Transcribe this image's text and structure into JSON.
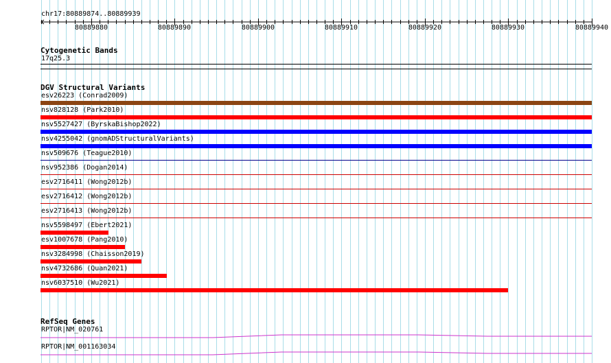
{
  "ruler": {
    "region": "chr17:80889874..80889939",
    "ticks": [
      "80889880",
      "80889890",
      "80889900",
      "80889910",
      "80889920",
      "80889930",
      "80889940"
    ]
  },
  "cytogenetic": {
    "title": "Cytogenetic Bands",
    "band": "17q25.3"
  },
  "dgv": {
    "title": "DGV Structural Variants",
    "variants": [
      {
        "label": "esv26223 (Conrad2009)",
        "color": "#8b4513",
        "style": "thick",
        "extent": "full"
      },
      {
        "label": "nsv828128 (Park2010)",
        "color": "#ff0000",
        "style": "thick",
        "extent": "full"
      },
      {
        "label": "nsv5527427 (ByrskaBishop2022)",
        "color": "#0000ff",
        "style": "thick",
        "extent": "full"
      },
      {
        "label": "nsv4255042 (gnomADStructuralVariants)",
        "color": "#0000ff",
        "style": "thick",
        "extent": "full"
      },
      {
        "label": "nsv509676 (Teague2010)",
        "color": "#00008b",
        "style": "thin",
        "extent": "full"
      },
      {
        "label": "nsv952386 (Dogan2014)",
        "color": "#cc0000",
        "style": "thin",
        "extent": "full"
      },
      {
        "label": "esv2716411 (Wong2012b)",
        "color": "#cc0000",
        "style": "thin",
        "extent": "full"
      },
      {
        "label": "esv2716412 (Wong2012b)",
        "color": "#cc0000",
        "style": "thin",
        "extent": "full"
      },
      {
        "label": "esv2716413 (Wong2012b)",
        "color": "#cc0000",
        "style": "thin",
        "extent": "full"
      },
      {
        "label": "nsv5598497 (Ebert2021)",
        "color": "#ff0000",
        "style": "thick",
        "extent": "left"
      },
      {
        "label": "esv1007678 (Pang2010)",
        "color": "#ff0000",
        "style": "thick",
        "extent": "left"
      },
      {
        "label": "nsv3284998 (Chaisson2019)",
        "color": "#ff0000",
        "style": "thick",
        "extent": "left"
      },
      {
        "label": "nsv4732686 (Quan2021)",
        "color": "#ff0000",
        "style": "thick",
        "extent": "left"
      },
      {
        "label": "nsv6037510 (Wu2021)",
        "color": "#ff0000",
        "style": "thick",
        "extent": "left"
      }
    ]
  },
  "refseq": {
    "title": "RefSeq Genes",
    "genes": [
      {
        "label": "RPTOR|NM_020761",
        "color": "#cc33cc"
      },
      {
        "label": "RPTOR|NM_001163034",
        "color": "#cc33cc"
      }
    ]
  }
}
